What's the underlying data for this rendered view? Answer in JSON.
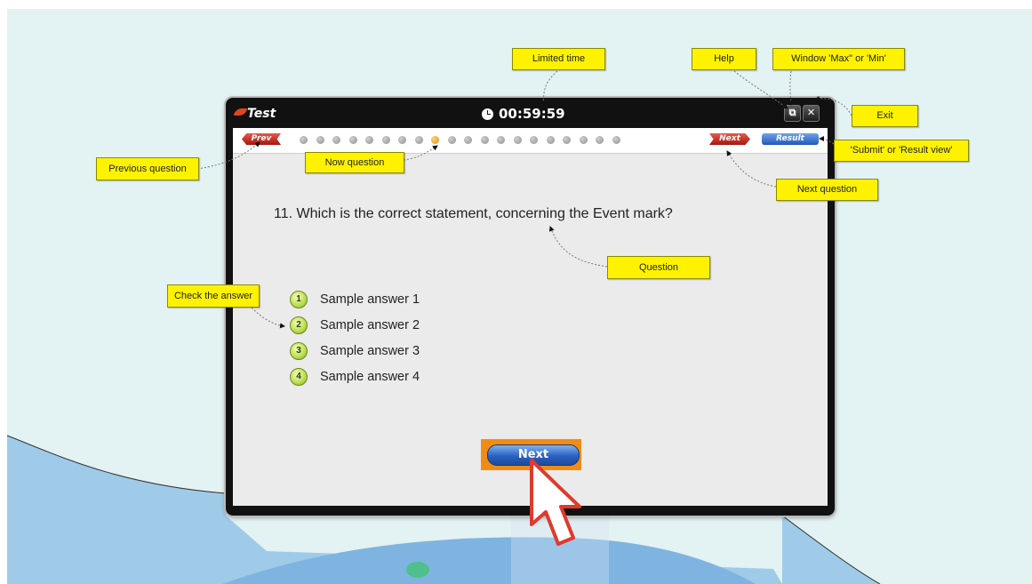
{
  "window": {
    "title": "Test",
    "timer": "00:59:59",
    "help_label": "⧉",
    "close_label": "✕"
  },
  "nav": {
    "prev_label": "Prev",
    "next_label": "Next",
    "result_label": "Result",
    "question_count": 20,
    "current_index": 8
  },
  "question": {
    "number": "11.",
    "text": "Which is the correct statement, concerning the Event mark?"
  },
  "answers": [
    {
      "num": "1",
      "text": "Sample answer 1"
    },
    {
      "num": "2",
      "text": "Sample answer 2"
    },
    {
      "num": "3",
      "text": "Sample answer 3"
    },
    {
      "num": "4",
      "text": "Sample answer 4"
    }
  ],
  "footer": {
    "next_label": "Next"
  },
  "callouts": {
    "limited_time": "Limited time",
    "help": "Help",
    "window_max_min": "Window 'Max\" or 'Min'",
    "exit": "Exit",
    "submit_result": "'Submit' or 'Result view'",
    "next_question": "Next question",
    "previous_question": "Previous question",
    "now_question": "Now question",
    "question": "Question",
    "check_answer": "Check the answer"
  },
  "colors": {
    "callout": "#fff200",
    "highlight": "#f08c14",
    "map_land": "#e6f3f3",
    "map_water": "#9cc8ea"
  }
}
